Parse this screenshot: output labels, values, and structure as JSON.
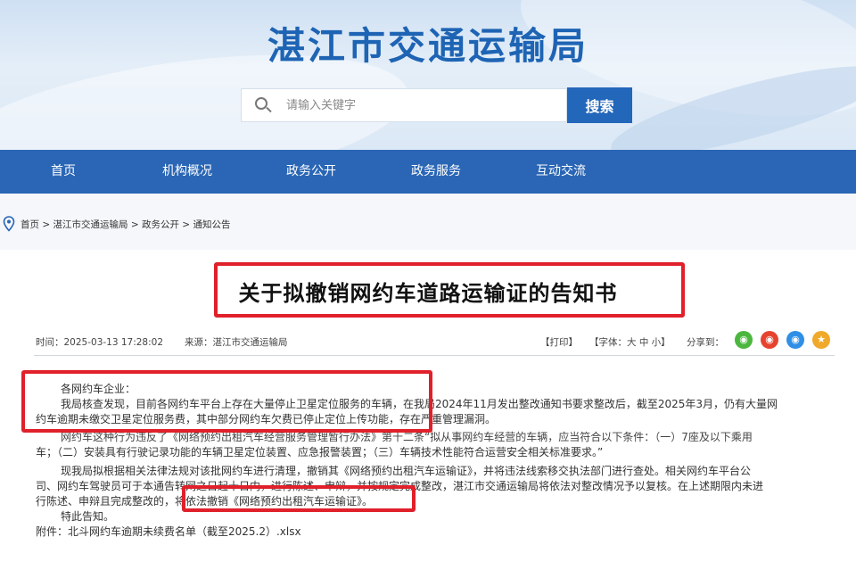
{
  "header": {
    "site_title": "湛江市交通运输局",
    "search": {
      "placeholder": "请输入关键字",
      "button_label": "搜索"
    }
  },
  "nav": {
    "items": [
      "首页",
      "机构概况",
      "政务公开",
      "政务服务",
      "互动交流"
    ]
  },
  "breadcrumb": {
    "items": [
      "首页",
      "湛江市交通运输局",
      "政务公开",
      "通知公告"
    ],
    "separator": " > "
  },
  "article": {
    "title": "关于拟撤销网约车道路运输证的告知书",
    "meta": {
      "time": "时间：2025-03-13 17:28:02",
      "source": "来源：湛江市交通运输局",
      "print": "【打印】",
      "font_size": "【字体：大 中 小】",
      "share_label": "分享到："
    },
    "share_icons": [
      {
        "name": "wechat-icon",
        "glyph": "◉",
        "color": "#4cb63f"
      },
      {
        "name": "weibo-icon",
        "glyph": "◉",
        "color": "#e6432f"
      },
      {
        "name": "qq-icon",
        "glyph": "◉",
        "color": "#2f8fe6"
      },
      {
        "name": "favorite-icon",
        "glyph": "★",
        "color": "#f0a92a"
      }
    ],
    "paragraphs": [
      "各网约车企业：",
      "我局核查发现，目前各网约车平台上存在大量停止卫星定位服务的车辆，在我局2024年11月发出整改通知书要求整改后，截至2025年3月，仍有大量网",
      "约车逾期未缴交卫星定位服务费，其中部分网约车欠费已停止定位上传功能，存在严重管理漏洞。",
      "网约车这种行为违反了《网络预约出租汽车经营服务管理暂行办法》第十二条“拟从事网约车经营的车辆，应当符合以下条件：（一）7座及以下乘用",
      "车；（二）安装具有行驶记录功能的车辆卫星定位装置、应急报警装置；（三）车辆技术性能符合运营安全相关标准要求。”",
      "现我局拟根据相关法律法规对该批网约车进行清理，撤销其《网络预约出租汽车运输证》，并将违法线索移交执法部门进行查处。相关网约车平台公",
      "司、网约车驾驶员可于本通告转网之日起十日内，进行陈述、申辩，并按规定完成整改，湛江市交通运输局将依法对整改情况予以复核。在上述期限内未进",
      "行陈述、申辩且完成整改的，将依法撤销《网络预约出租汽车运输证》。",
      "特此告知。",
      "附件：北斗网约车逾期未续费名单（截至2025.2）.xlsx"
    ]
  },
  "colors": {
    "brand_blue": "#2a66b5",
    "title_blue": "#1e64b4",
    "highlight_red": "#e0202a"
  }
}
